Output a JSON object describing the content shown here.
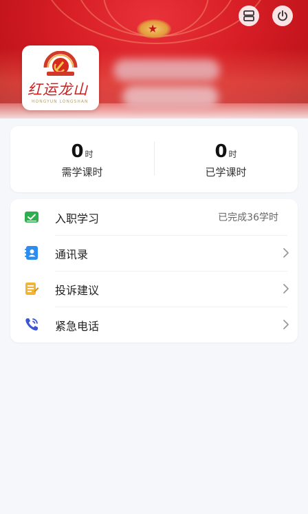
{
  "header": {
    "logo": {
      "script_text": "红运龙山",
      "small_text": "HONGYUN LONGSHAN"
    }
  },
  "stats": [
    {
      "value": "0",
      "unit": "时",
      "label": "需学课时"
    },
    {
      "value": "0",
      "unit": "时",
      "label": "已学课时"
    }
  ],
  "menu": [
    {
      "label": "入职学习",
      "right_text": "已完成36学时",
      "icon": "certificate-icon",
      "icon_color": "#2fae4f"
    },
    {
      "label": "通讯录",
      "right_text": "",
      "icon": "contacts-icon",
      "icon_color": "#2d8cf0"
    },
    {
      "label": "投诉建议",
      "right_text": "",
      "icon": "feedback-icon",
      "icon_color": "#f2b533"
    },
    {
      "label": "紧急电话",
      "right_text": "",
      "icon": "phone-icon",
      "icon_color": "#3a56d4"
    }
  ],
  "colors": {
    "header_red": "#d81e26",
    "page_bg": "#f5f7fa"
  }
}
